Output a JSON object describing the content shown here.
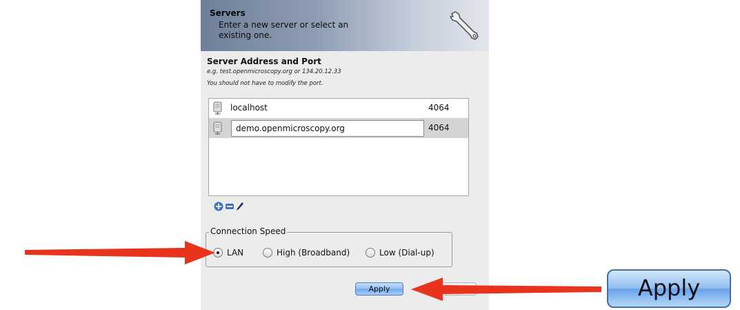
{
  "header": {
    "title": "Servers",
    "description": "Enter a new server or select an existing one."
  },
  "server_section": {
    "title": "Server Address and Port",
    "hint1": "e.g. test.openmicroscopy.org or 134.20.12.33",
    "hint2": "You should not have to modify the port."
  },
  "servers": [
    {
      "name": "localhost",
      "port": "4064"
    },
    {
      "name": "demo.openmicroscopy.org",
      "port": "4064"
    }
  ],
  "toolbar": {
    "add_icon": "plus-circle-icon",
    "remove_icon": "minus-icon",
    "edit_icon": "pencil-icon"
  },
  "connection": {
    "legend": "Connection Speed",
    "options": [
      "LAN",
      "High (Broadband)",
      "Low (Dial-up)"
    ],
    "selected": "LAN"
  },
  "apply_label": "Apply",
  "apply_zoom_label": "Apply",
  "colors": {
    "arrow": "#e8341c",
    "button_blue": "#6fa7ea",
    "header_dark": "#6f7f99"
  }
}
